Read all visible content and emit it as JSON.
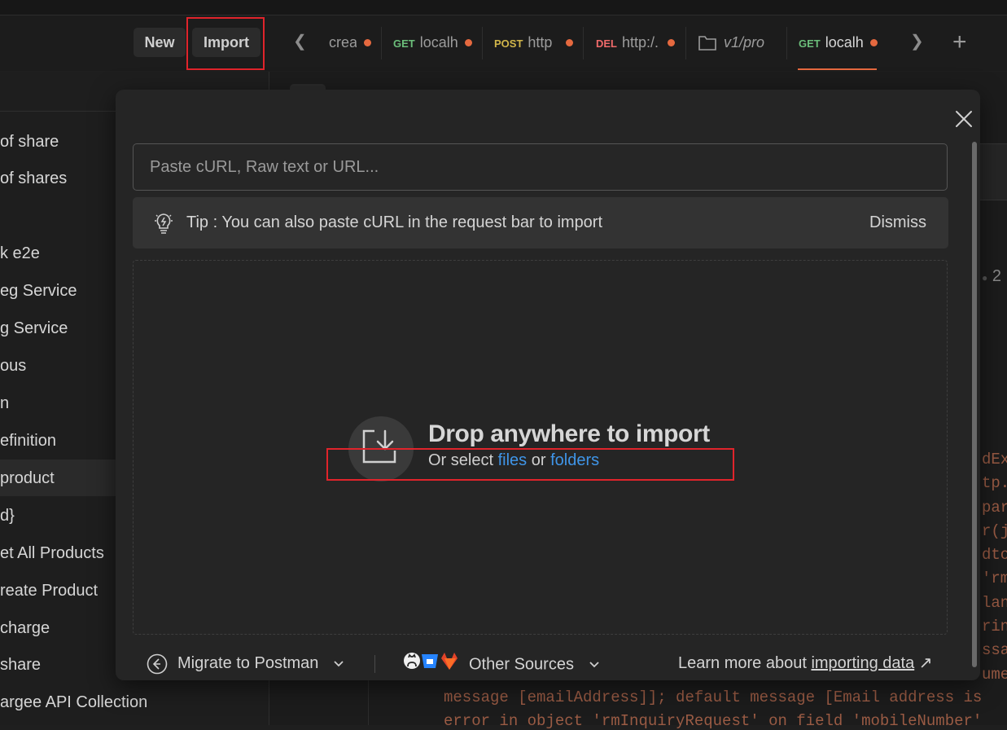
{
  "toolbar": {
    "new_label": "New",
    "import_label": "Import"
  },
  "tabs": [
    {
      "method": "",
      "title": "crea"
    },
    {
      "method": "GET",
      "title": "localh"
    },
    {
      "method": "POST",
      "title": "http"
    },
    {
      "method": "DEL",
      "title": "http:/."
    },
    {
      "method": "",
      "title": "v1/pro"
    },
    {
      "method": "GET",
      "title": "localh"
    }
  ],
  "sidebar": {
    "items": [
      "of share",
      "of shares",
      "k e2e",
      "eg Service",
      "g Service",
      "ous",
      "n",
      "efinition",
      "product",
      "d}",
      "et All Products",
      "reate Product",
      " charge",
      " share",
      "argee API Collection"
    ]
  },
  "editor": {
    "code_right": [
      "dEx",
      "tp.",
      "par",
      "r(j",
      "dto",
      "'rm",
      "lan",
      "rin",
      "ssa",
      "umen"
    ],
    "code_line1": "message [emailAddress]]; default message [Email address is",
    "code_line2": "error in object 'rmInquiryRequest' on field 'mobileNumber'",
    "line_num": "2"
  },
  "modal": {
    "search_placeholder": "Paste cURL, Raw text or URL...",
    "tip_text": "Tip : You can also paste cURL in the request bar to import",
    "dismiss_label": "Dismiss",
    "drop_title": "Drop anywhere to import",
    "drop_prefix": "Or select",
    "files_label": "files",
    "or_label": "or",
    "folders_label": "folders",
    "footer": {
      "migrate_label": "Migrate to Postman",
      "other_sources_label": "Other Sources",
      "learn_prefix": "Learn more about",
      "learn_link": "importing data",
      "learn_arrow": "↗"
    }
  },
  "colors": {
    "accent": "#e5693f",
    "link": "#3f95e8",
    "highlight": "#e0242b",
    "get": "#6bbd7a",
    "post": "#d1b54a",
    "delete": "#ef6a6a"
  }
}
